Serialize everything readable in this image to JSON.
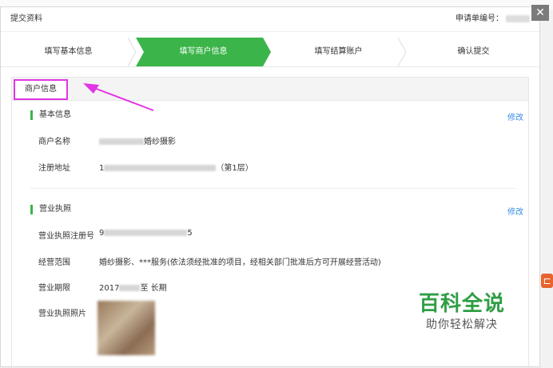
{
  "modal": {
    "title": "提交资料",
    "application_no_label": "申请单编号：",
    "close": "✕"
  },
  "steps": [
    {
      "label": "填写基本信息"
    },
    {
      "label": "填写商户信息"
    },
    {
      "label": "填写结算账户"
    },
    {
      "label": "确认提交"
    }
  ],
  "section": {
    "title": "商户信息"
  },
  "basic": {
    "title": "基本信息",
    "edit": "修改",
    "merchant_name_label": "商户名称",
    "merchant_name_suffix": "婚纱摄影",
    "address_label": "注册地址",
    "address_prefix": "1",
    "address_suffix": "（第1层）"
  },
  "license": {
    "title": "营业执照",
    "edit": "修改",
    "reg_no_label": "营业执照注册号",
    "reg_no_prefix": "9",
    "reg_no_suffix": "5",
    "scope_label": "经营范围",
    "scope_value": "婚纱摄影、***服务(依法须经批准的项目，经相关部门批准后方可开展经营活动)",
    "period_label": "营业期限",
    "period_prefix": "2017",
    "period_suffix": "至 长期",
    "photo_label": "营业执照照片"
  },
  "watermark": {
    "big": "百科全说",
    "small": "助你轻松解决"
  },
  "colors": {
    "accent_green": "#3bb44a",
    "link_blue": "#3a8ee6",
    "highlight_magenta": "#e236e6"
  }
}
